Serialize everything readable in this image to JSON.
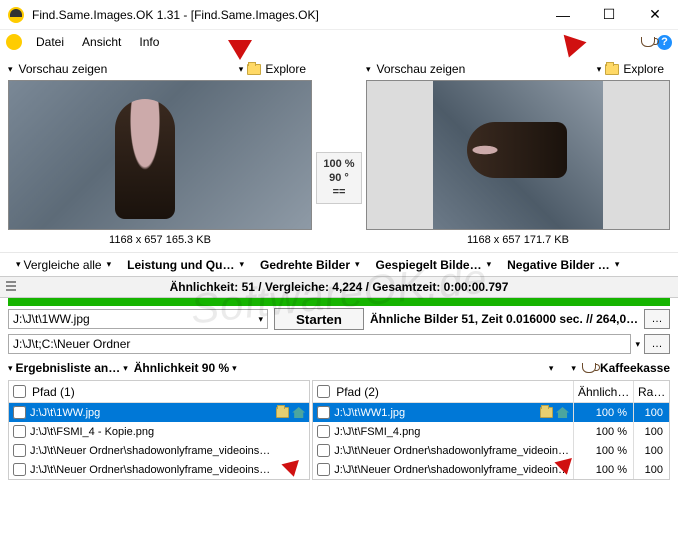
{
  "titlebar": {
    "title": "Find.Same.Images.OK 1.31 - [Find.Same.Images.OK]"
  },
  "menubar": {
    "items": [
      "Datei",
      "Ansicht",
      "Info"
    ]
  },
  "preview": {
    "show_label": "Vorschau zeigen",
    "explore_label": "Explore",
    "left_caption": "1168 x 657 165.3 KB",
    "right_caption": "1168 x 657 171.7 KB",
    "center": {
      "zoom": "100 %",
      "rotation": "90 °",
      "flip": "=="
    }
  },
  "options": {
    "compare_all": "Vergleiche alle",
    "performance": "Leistung und Qu…",
    "rotated": "Gedrehte Bilder",
    "mirrored": "Gespiegelt Bilde…",
    "negative": "Negative Bilder …"
  },
  "stats": "Ähnlichkeit: 51 / Vergleiche: 4,224 / Gesamtzeit: 0:00:00.797",
  "start": {
    "dropdown_path": "J:\\J\\t\\1WW.jpg",
    "button": "Starten",
    "status": "Ähnliche Bilder 51, Zeit 0.016000 sec. // 264,0…"
  },
  "path_input": "J:\\J\\t;C:\\Neuer Ordner",
  "list_toolbar": {
    "results_view": "Ergebnisliste an…",
    "similarity": "Ähnlichkeit 90 %",
    "donate": "Kaffeekasse"
  },
  "results": {
    "left": {
      "header": "Pfad (1)",
      "rows": [
        {
          "text": "J:\\J\\t\\1WW.jpg",
          "selected": true,
          "icons": true
        },
        {
          "text": "J:\\J\\t\\FSMI_4 - Kopie.png"
        },
        {
          "text": "J:\\J\\t\\Neuer Ordner\\shadowonlyframe_videoins…"
        },
        {
          "text": "J:\\J\\t\\Neuer Ordner\\shadowonlyframe_videoins…"
        }
      ]
    },
    "right": {
      "header": "Pfad (2)",
      "sim_header": "Ähnlich…",
      "rank_header": "Ra…",
      "rows": [
        {
          "text": "J:\\J\\t\\WW1.jpg",
          "selected": true,
          "icons": true,
          "sim": "100 %",
          "rank": "100"
        },
        {
          "text": "J:\\J\\t\\FSMI_4.png",
          "sim": "100 %",
          "rank": "100"
        },
        {
          "text": "J:\\J\\t\\Neuer Ordner\\shadowonlyframe_videoin…",
          "sim": "100 %",
          "rank": "100"
        },
        {
          "text": "J:\\J\\t\\Neuer Ordner\\shadowonlyframe_videoin…",
          "sim": "100 %",
          "rank": "100"
        }
      ]
    }
  },
  "watermark": "SoftwareOK.de"
}
